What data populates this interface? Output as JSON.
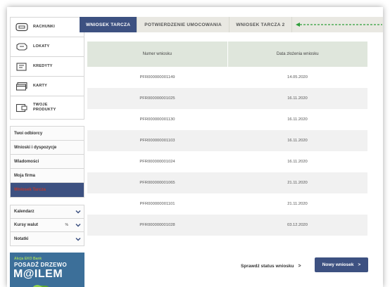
{
  "sidebar": {
    "products": [
      {
        "label": "RACHUNKI",
        "icon": "account-icon"
      },
      {
        "label": "LOKATY",
        "icon": "piggybank-icon"
      },
      {
        "label": "KREDYTY",
        "icon": "loan-icon"
      },
      {
        "label": "KARTY",
        "icon": "card-icon"
      },
      {
        "label": "TWOJE PRODUKTY",
        "icon": "products-icon"
      }
    ],
    "nav": [
      {
        "label": "Twoi odbiorcy"
      },
      {
        "label": "Wnioski i dyspozycje"
      },
      {
        "label": "Wiadomości"
      },
      {
        "label": "Moja firma"
      },
      {
        "label": "Wniosek Tarcza"
      }
    ],
    "dropdowns": [
      {
        "label": "Kalendarz",
        "extra": ""
      },
      {
        "label": "Kursy walut",
        "extra": "%"
      },
      {
        "label": "Notatki",
        "extra": ""
      }
    ],
    "banner": {
      "line1": "Akcja EKO Bank",
      "line2": "POSADŹ DRZEWO",
      "line3": "M@ILEM"
    }
  },
  "tabs": [
    {
      "label": "WNIOSEK TARCZA",
      "active": true
    },
    {
      "label": "POTWIERDZENIE UMOCOWANIA",
      "active": false
    },
    {
      "label": "WNIOSEK TARCZA 2",
      "active": false
    }
  ],
  "table": {
    "headers": [
      "Numer wniosku",
      "Data złożenia wniosku"
    ],
    "rows": [
      [
        "PFR000000001149",
        "14.05.2020"
      ],
      [
        "PFR000000001025",
        "16.11.2020"
      ],
      [
        "PFR000000001130",
        "16.11.2020"
      ],
      [
        "PFR000000001103",
        "16.11.2020"
      ],
      [
        "PFR000000001024",
        "16.11.2020"
      ],
      [
        "PFR000000001065",
        "21.11.2020"
      ],
      [
        "PFR000000001101",
        "21.11.2020"
      ],
      [
        "PFR000000001028",
        "03.12.2020"
      ]
    ]
  },
  "actions": {
    "status_label": "Sprawdź status wniosku",
    "status_chevron": ">",
    "new_label": "Nowy wniosek",
    "new_chevron": ">"
  },
  "colors": {
    "primary": "#3d5181",
    "header_bg": "#dfe6dc",
    "tab_bg": "#e9e8e2",
    "active_nav_text": "#c0392b",
    "arrow": "#2e9e3a",
    "banner_bg": "#3c6f99"
  }
}
